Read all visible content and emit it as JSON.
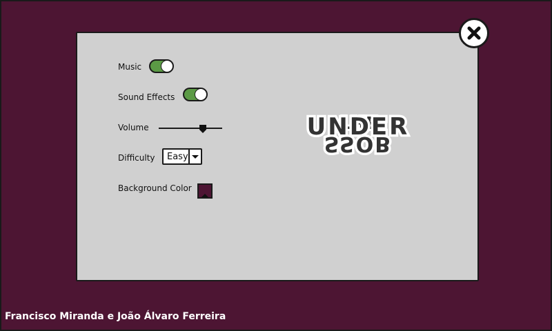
{
  "colors": {
    "background": "#4d1533",
    "panel": "#d0d0d0",
    "toggle_on": "#5b9a45"
  },
  "settings": {
    "music_label": "Music",
    "music_on": true,
    "sound_effects_label": "Sound Effects",
    "sound_effects_on": true,
    "volume_label": "Volume",
    "volume_level": 0.7,
    "difficulty_label": "Difficulty",
    "difficulty_value": "Easy",
    "background_color_label": "Background Color",
    "background_color_value": "#4d1533"
  },
  "logo": {
    "line1": "THE",
    "line2": "UNDER",
    "line3": "SSOB"
  },
  "icons": {
    "close": "close-icon",
    "dropdown": "chevron-down-icon"
  },
  "footer": {
    "credit": "Francisco Miranda e João Álvaro Ferreira"
  }
}
